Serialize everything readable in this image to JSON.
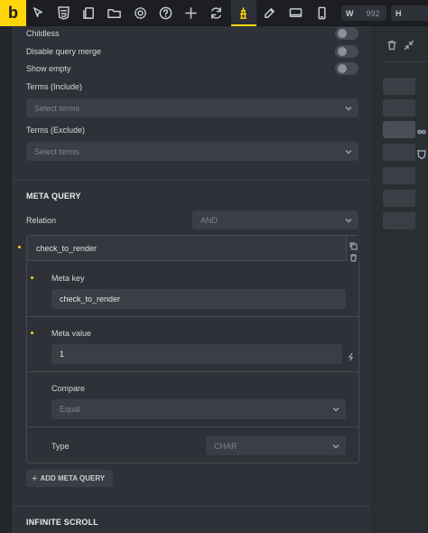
{
  "toolbar": {
    "logo": "b",
    "icons": [
      "cursor-icon",
      "html5-icon",
      "pages-icon",
      "folder-icon",
      "settings-icon",
      "help-icon",
      "add-icon",
      "refresh-icon",
      "bricks-icon",
      "edit-icon",
      "desktop-icon",
      "mobile-icon"
    ],
    "width_label": "W",
    "width_value": "992",
    "height_label": "H"
  },
  "query": {
    "childless_label": "Childless",
    "disable_merge_label": "Disable query merge",
    "show_empty_label": "Show empty",
    "terms_include_label": "Terms (Include)",
    "terms_include_placeholder": "Select terms",
    "terms_exclude_label": "Terms (Exclude)",
    "terms_exclude_placeholder": "Select terms"
  },
  "meta_query": {
    "title": "META QUERY",
    "relation_label": "Relation",
    "relation_value": "AND",
    "item_title": "check_to_render",
    "meta_key_label": "Meta key",
    "meta_key_value": "check_to_render",
    "meta_value_label": "Meta value",
    "meta_value_value": "1",
    "compare_label": "Compare",
    "compare_value": "Equal",
    "type_label": "Type",
    "type_value": "CHAR",
    "add_button": "ADD META QUERY"
  },
  "infinite_scroll": {
    "title": "INFINITE SCROLL"
  },
  "colors": {
    "accent": "#ffd60a",
    "panel_bg": "#2e3238",
    "field_bg": "#3a3e45"
  }
}
